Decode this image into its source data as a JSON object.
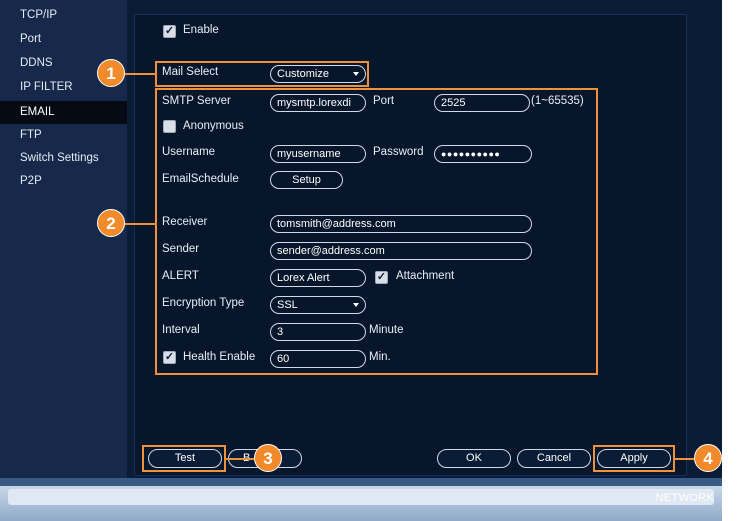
{
  "sidebar": {
    "items": [
      {
        "label": "TCP/IP"
      },
      {
        "label": "Port"
      },
      {
        "label": "DDNS"
      },
      {
        "label": "IP FILTER"
      },
      {
        "label": "EMAIL"
      },
      {
        "label": "FTP"
      },
      {
        "label": "Switch Settings"
      },
      {
        "label": "P2P"
      }
    ],
    "active": "EMAIL"
  },
  "form": {
    "enable": {
      "label": "Enable",
      "checked": true
    },
    "mail_select": {
      "label": "Mail Select",
      "value": "Customize"
    },
    "smtp_server": {
      "label": "SMTP Server",
      "value": "mysmtp.lorexdi"
    },
    "port": {
      "label": "Port",
      "value": "2525",
      "range": "(1~65535)"
    },
    "anonymous": {
      "label": "Anonymous",
      "checked": false
    },
    "username": {
      "label": "Username",
      "value": "myusername"
    },
    "password": {
      "label": "Password",
      "value": "●●●●●●●●●●"
    },
    "email_schedule": {
      "label": "EmailSchedule",
      "button": "Setup"
    },
    "receiver": {
      "label": "Receiver",
      "value": "tomsmith@address.com"
    },
    "sender": {
      "label": "Sender",
      "value": "sender@address.com"
    },
    "alert": {
      "label": "ALERT",
      "value": "Lorex Alert"
    },
    "attachment": {
      "label": "Attachment",
      "checked": true
    },
    "encryption_type": {
      "label": "Encryption Type",
      "value": "SSL"
    },
    "interval": {
      "label": "Interval",
      "value": "3",
      "unit": "Minute"
    },
    "health_enable": {
      "label": "Health Enable",
      "checked": true,
      "value": "60",
      "unit": "Min."
    }
  },
  "buttons": {
    "test": "Test",
    "backup_partial": "B",
    "ok": "OK",
    "cancel": "Cancel",
    "apply": "Apply"
  },
  "callouts": [
    "1",
    "2",
    "3",
    "4"
  ],
  "footer": {
    "title": "NETWORK"
  },
  "colors": {
    "accent_orange": "#f0923c",
    "panel_bg": "#07162b",
    "sidebar_bg": "#16294a",
    "active_item_bg": "#060a12"
  }
}
